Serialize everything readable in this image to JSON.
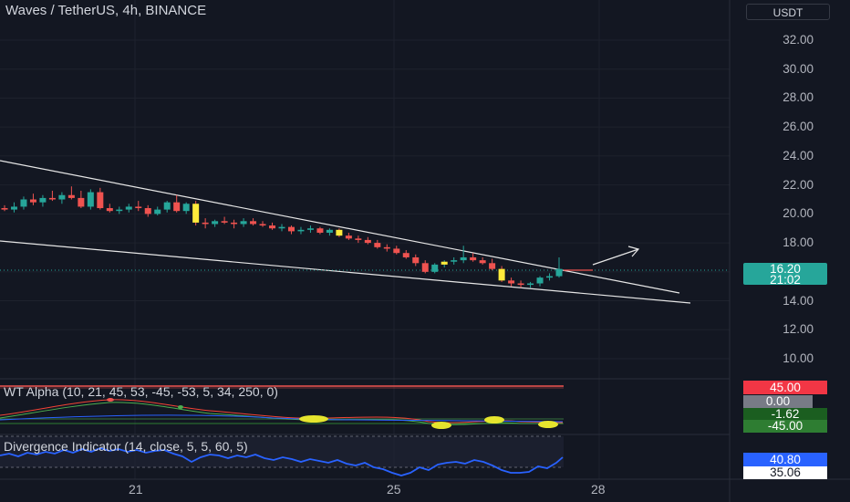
{
  "header": {
    "title": "Waves / TetherUS, 4h, BINANCE",
    "currency": "USDT"
  },
  "price_axis": {
    "ticks": [
      "32.00",
      "30.00",
      "28.00",
      "26.00",
      "24.00",
      "22.00",
      "20.00",
      "18.00",
      "16.00",
      "14.00",
      "12.00",
      "10.00"
    ]
  },
  "current_price": {
    "price": "16.20",
    "countdown": "21:02"
  },
  "wt_alpha": {
    "title": "WT Alpha (10, 21, 45, 53, -45, -53, 5, 34, 250, 0)",
    "labels": [
      "45.00",
      "0.00",
      "-1.62",
      "-45.00"
    ]
  },
  "divergence": {
    "title": "Divergence Indicator (14, close, 5, 5, 60, 5)",
    "labels": [
      "40.80",
      "35.06"
    ]
  },
  "time_axis": {
    "labels": [
      "21",
      "25",
      "28"
    ]
  },
  "colors": {
    "up": "#26a69a",
    "down": "#ef5350",
    "highlight": "#ffeb3b",
    "rsi": "#2962ff"
  },
  "chart_data": {
    "type": "candlestick",
    "symbol": "Waves / TetherUS",
    "interval": "4h",
    "ylim": [
      9.0,
      33.0
    ],
    "candles": [
      [
        20.4,
        20.6,
        20.2,
        20.3
      ],
      [
        20.3,
        20.8,
        20.1,
        20.5
      ],
      [
        20.5,
        21.2,
        20.3,
        21.0
      ],
      [
        21.0,
        21.4,
        20.6,
        20.8
      ],
      [
        20.8,
        21.3,
        20.5,
        21.1
      ],
      [
        21.1,
        21.6,
        20.9,
        21.0
      ],
      [
        21.0,
        21.5,
        20.7,
        21.3
      ],
      [
        21.3,
        21.9,
        21.0,
        21.1
      ],
      [
        21.1,
        21.6,
        20.4,
        20.5
      ],
      [
        20.5,
        21.7,
        20.3,
        21.5
      ],
      [
        21.5,
        21.8,
        20.3,
        20.4
      ],
      [
        20.4,
        20.7,
        20.1,
        20.2
      ],
      [
        20.2,
        20.5,
        20.0,
        20.3
      ],
      [
        20.3,
        20.7,
        20.1,
        20.5
      ],
      [
        20.5,
        20.9,
        20.2,
        20.4
      ],
      [
        20.4,
        20.6,
        19.8,
        20.0
      ],
      [
        20.0,
        20.5,
        19.9,
        20.3
      ],
      [
        20.3,
        20.9,
        20.1,
        20.8
      ],
      [
        20.8,
        21.3,
        20.1,
        20.2
      ],
      [
        20.2,
        20.8,
        20.0,
        20.7
      ],
      [
        20.7,
        20.9,
        19.2,
        19.4
      ],
      [
        19.4,
        19.7,
        19.0,
        19.3
      ],
      [
        19.3,
        19.6,
        19.1,
        19.5
      ],
      [
        19.5,
        19.8,
        19.3,
        19.4
      ],
      [
        19.4,
        19.6,
        19.0,
        19.3
      ],
      [
        19.3,
        19.7,
        19.1,
        19.5
      ],
      [
        19.5,
        19.7,
        19.2,
        19.3
      ],
      [
        19.3,
        19.5,
        19.1,
        19.2
      ],
      [
        19.2,
        19.4,
        18.9,
        19.0
      ],
      [
        19.0,
        19.3,
        18.8,
        19.1
      ],
      [
        19.1,
        19.2,
        18.6,
        18.8
      ],
      [
        18.8,
        19.1,
        18.6,
        18.9
      ],
      [
        18.9,
        19.2,
        18.7,
        19.0
      ],
      [
        19.0,
        19.1,
        18.6,
        18.7
      ],
      [
        18.7,
        19.0,
        18.5,
        18.9
      ],
      [
        18.9,
        19.0,
        18.4,
        18.5
      ],
      [
        18.5,
        18.7,
        18.2,
        18.3
      ],
      [
        18.3,
        18.5,
        18.0,
        18.2
      ],
      [
        18.2,
        18.4,
        17.9,
        18.0
      ],
      [
        18.0,
        18.2,
        17.6,
        17.7
      ],
      [
        17.7,
        17.9,
        17.4,
        17.6
      ],
      [
        17.6,
        17.8,
        17.2,
        17.3
      ],
      [
        17.3,
        17.5,
        16.9,
        17.0
      ],
      [
        17.0,
        17.2,
        16.4,
        16.6
      ],
      [
        16.6,
        16.8,
        15.9,
        16.0
      ],
      [
        16.0,
        16.6,
        15.9,
        16.5
      ],
      [
        16.5,
        16.8,
        16.3,
        16.7
      ],
      [
        16.7,
        17.0,
        16.5,
        16.8
      ],
      [
        16.8,
        17.8,
        16.6,
        17.0
      ],
      [
        17.0,
        17.3,
        16.7,
        16.8
      ],
      [
        16.8,
        17.0,
        16.5,
        16.6
      ],
      [
        16.6,
        16.9,
        16.1,
        16.2
      ],
      [
        16.2,
        16.4,
        15.3,
        15.4
      ],
      [
        15.4,
        15.6,
        15.0,
        15.2
      ],
      [
        15.2,
        15.4,
        14.9,
        15.1
      ],
      [
        15.1,
        15.3,
        14.9,
        15.2
      ],
      [
        15.2,
        15.7,
        15.0,
        15.6
      ],
      [
        15.6,
        15.9,
        15.4,
        15.7
      ],
      [
        15.7,
        17.0,
        15.6,
        16.2
      ]
    ]
  }
}
